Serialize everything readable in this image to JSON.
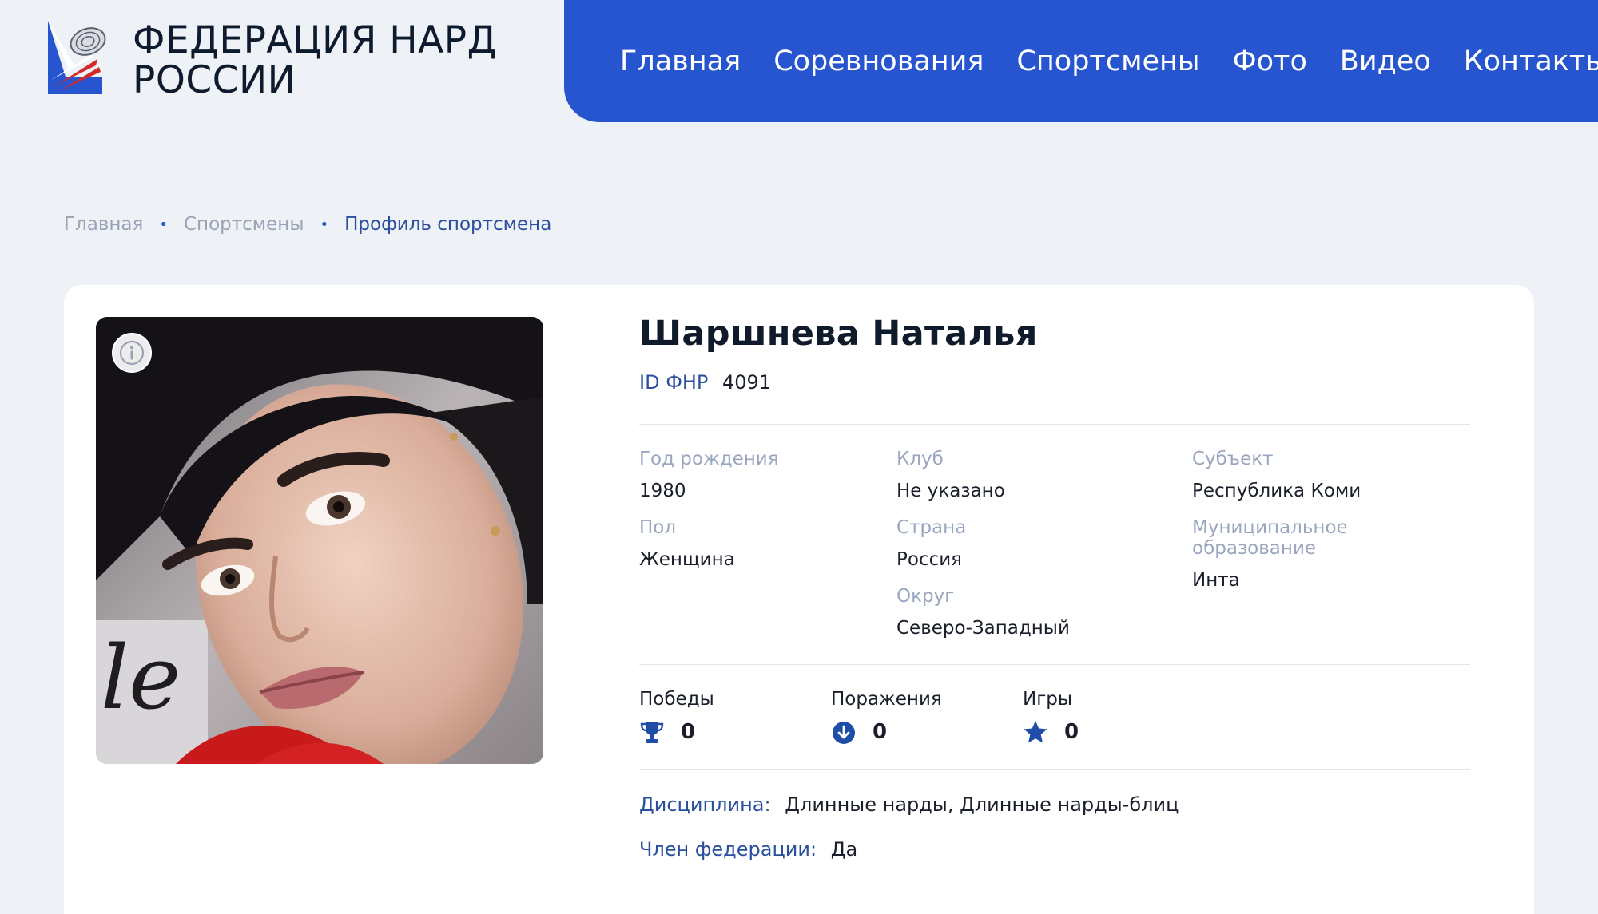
{
  "header": {
    "logo_line1": "ФЕДЕРАЦИЯ НАРД",
    "logo_line2": "РОССИИ",
    "nav": [
      "Главная",
      "Соревнования",
      "Спортсмены",
      "Фото",
      "Видео",
      "Контакты"
    ]
  },
  "breadcrumb": {
    "items": [
      "Главная",
      "Спортсмены"
    ],
    "current": "Профиль спортсмена",
    "separator": "•"
  },
  "profile": {
    "name": "Шаршнева Наталья",
    "id_label": "ID ФНР",
    "id_value": "4091",
    "fields": {
      "birth_year": {
        "label": "Год рождения",
        "value": "1980"
      },
      "gender": {
        "label": "Пол",
        "value": "Женщина"
      },
      "club": {
        "label": "Клуб",
        "value": "Не указано"
      },
      "country": {
        "label": "Страна",
        "value": "Россия"
      },
      "district": {
        "label": "Округ",
        "value": "Северо-Западный"
      },
      "subject": {
        "label": "Субъект",
        "value": "Республика Коми"
      },
      "municipality": {
        "label": "Муниципальное образование",
        "value": "Инта"
      }
    },
    "stats": {
      "wins": {
        "label": "Победы",
        "value": "0",
        "icon": "trophy-icon"
      },
      "losses": {
        "label": "Поражения",
        "value": "0",
        "icon": "arrow-down-circle-icon"
      },
      "games": {
        "label": "Игры",
        "value": "0",
        "icon": "star-icon"
      }
    },
    "discipline_label": "Дисциплина:",
    "discipline_value": "Длинные нарды, Длинные нарды-блиц",
    "member_label": "Член федерации:",
    "member_value": "Да"
  },
  "colors": {
    "accent": "#2755cf",
    "label_blue": "#2a4f9e",
    "muted": "#9aa6bf",
    "background": "#eef1f6"
  }
}
